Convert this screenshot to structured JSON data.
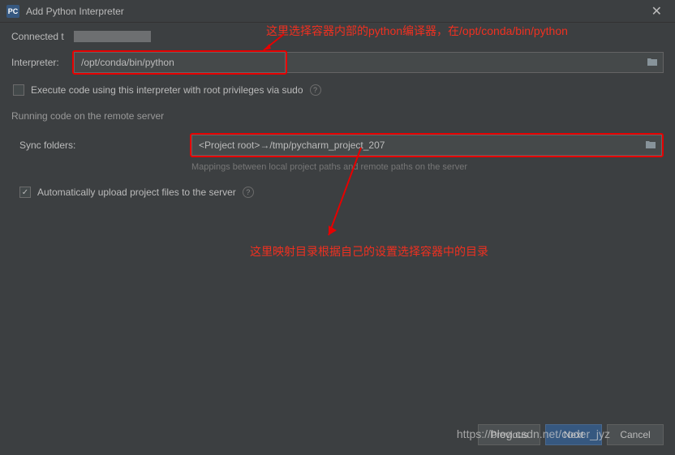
{
  "titlebar": {
    "app_icon": "PC",
    "title": "Add Python Interpreter"
  },
  "connected": {
    "label": "Connected t"
  },
  "interpreter": {
    "label": "Interpreter:",
    "value": "/opt/conda/bin/python"
  },
  "sudo": {
    "label": "Execute code using this interpreter with root privileges via sudo",
    "help": "?"
  },
  "remote": {
    "section_title": "Running code on the remote server",
    "sync_label": "Sync folders:",
    "sync_value": "<Project root>→/tmp/pycharm_project_207",
    "hint": "Mappings between local project paths and remote paths on the server",
    "auto_upload_label": "Automatically upload project files to the server",
    "help": "?"
  },
  "annotations": {
    "top": "这里选择容器内部的python编译器，在/opt/conda/bin/python",
    "bottom": "这里映射目录根据自己的设置选择容器中的目录"
  },
  "footer": {
    "previous": "Previous",
    "next": "Next",
    "cancel": "Cancel"
  },
  "watermark": "https://blog.csdn.net/coder_jyz"
}
